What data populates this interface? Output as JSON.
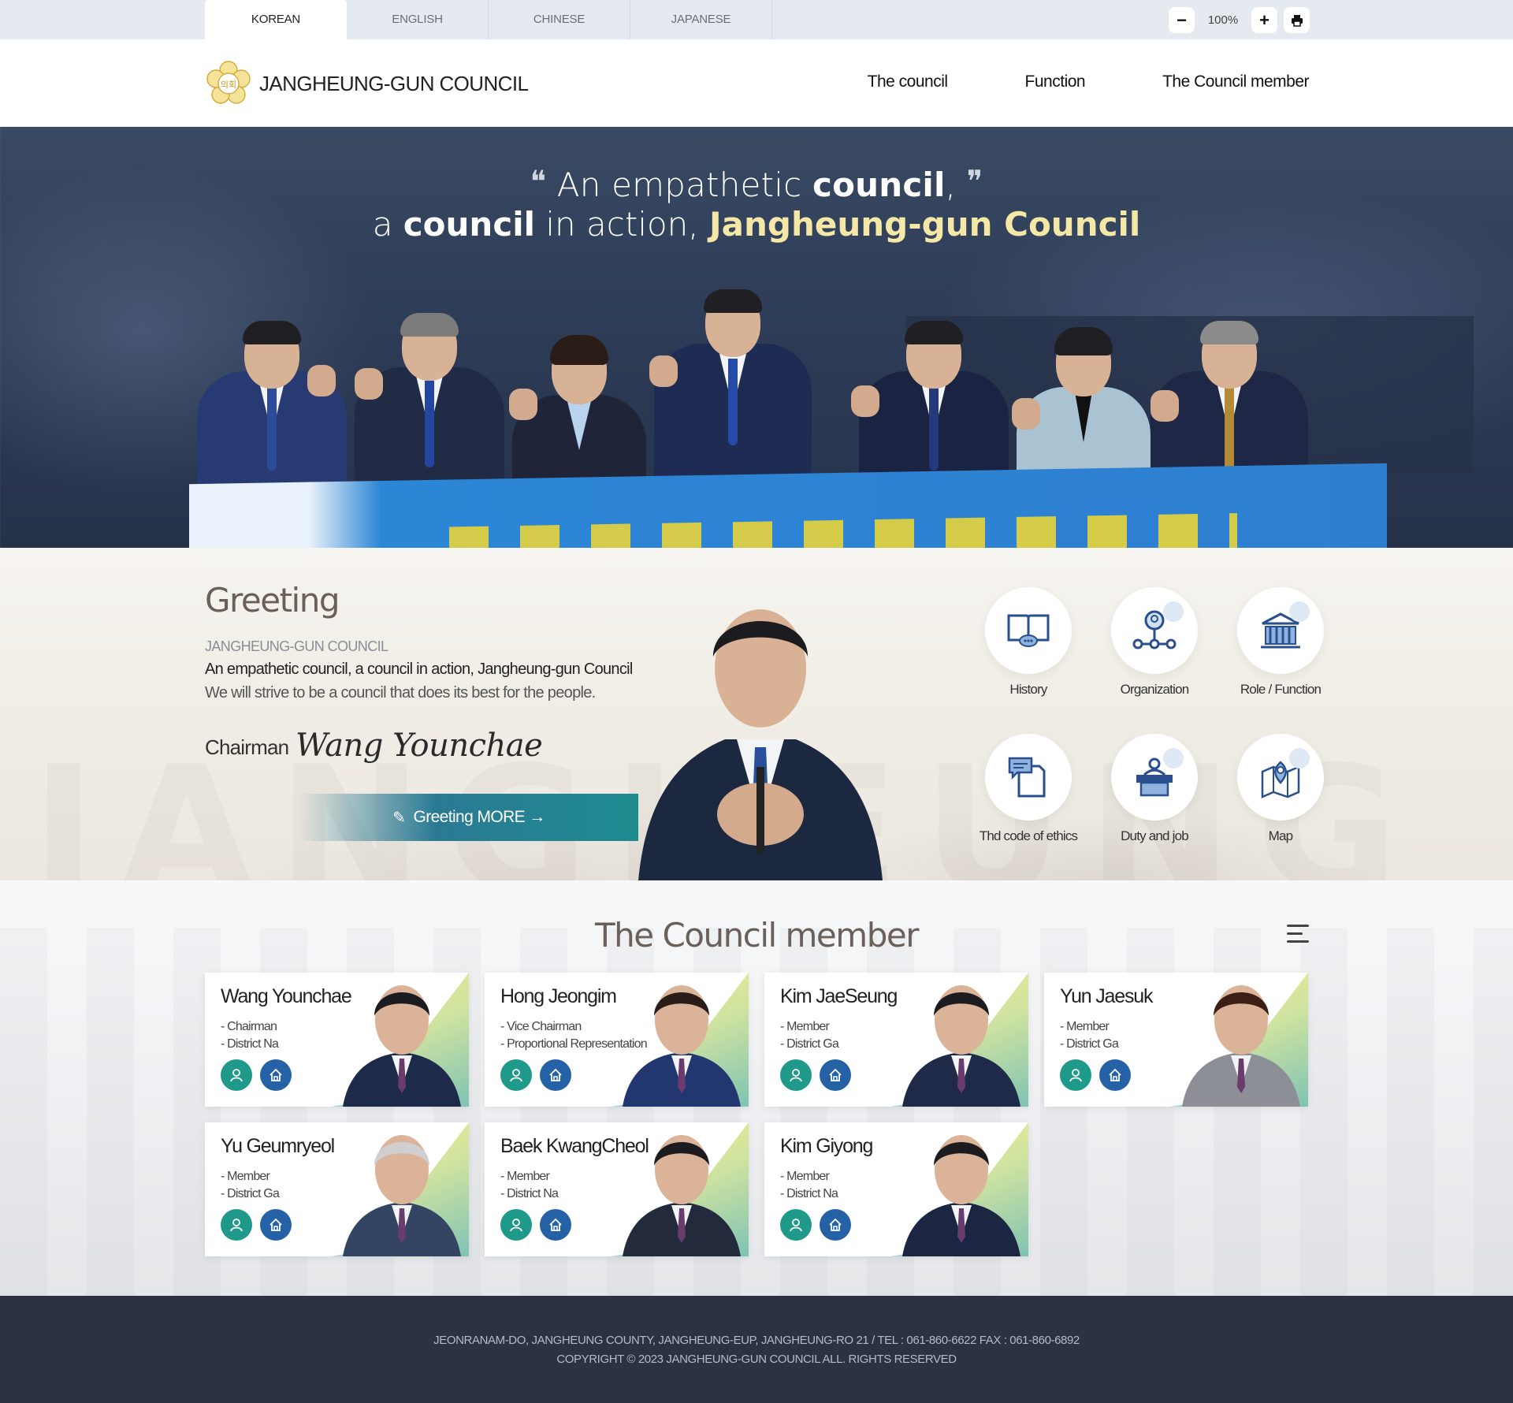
{
  "lang_tabs": [
    "KOREAN",
    "ENGLISH",
    "CHINESE",
    "JAPANESE"
  ],
  "tools": {
    "zoom_out": "−",
    "zoom_level": "100%",
    "zoom_in": "+",
    "print_icon": "print-icon"
  },
  "header": {
    "site_name": "JANGHEUNG-GUN COUNCIL",
    "emblem_text": "의회",
    "nav": [
      "The council",
      "Function",
      "The Council member"
    ]
  },
  "hero": {
    "open_quote": "❝",
    "line1_a": "An empathetic ",
    "line1_b": "council",
    "line1_c": ",",
    "close_quote": "❞",
    "line2_a": "a ",
    "line2_b": "council",
    "line2_c": " in action, ",
    "line2_d": "Jangheung-gun Council"
  },
  "greeting": {
    "title": "Greeting",
    "subtitle": "JANGHEUNG-GUN COUNCIL",
    "line1": "An empathetic council, a council in action, Jangheung-gun Council",
    "line2": "We will strive to be a council that does its best for the people.",
    "chairman_label": "Chairman",
    "signature": "Wang Younchae",
    "more_button": "Greeting MORE →"
  },
  "quick_links": [
    {
      "label": "History",
      "icon": "book-icon"
    },
    {
      "label": "Organization",
      "icon": "organization-icon"
    },
    {
      "label": "Role / Function",
      "icon": "building-icon"
    },
    {
      "label": "Thd code of ethics",
      "icon": "document-chat-icon"
    },
    {
      "label": "Duty and job",
      "icon": "podium-icon"
    },
    {
      "label": "Map",
      "icon": "map-pin-icon"
    }
  ],
  "members": {
    "title": "The Council member",
    "list": [
      {
        "name": "Wang Younchae",
        "role": "- Chairman",
        "district": "- District Na"
      },
      {
        "name": "Hong Jeongim",
        "role": "- Vice Chairman",
        "district": "- Proportional Representation"
      },
      {
        "name": "Kim JaeSeung",
        "role": "- Member",
        "district": "- District Ga"
      },
      {
        "name": "Yun Jaesuk",
        "role": "- Member",
        "district": "- District Ga"
      },
      {
        "name": "Yu Geumryeol",
        "role": "- Member",
        "district": "- District Ga"
      },
      {
        "name": "Baek KwangCheol",
        "role": "- Member",
        "district": "- District Na"
      },
      {
        "name": "Kim Giyong",
        "role": "- Member",
        "district": "- District Na"
      }
    ]
  },
  "footer": {
    "address": "JEONRANAM-DO, JANGHEUNG COUNTY, JANGHEUNG-EUP, JANGHEUNG-RO 21 / TEL : 061-860-6622 FAX : 061-860-6892",
    "copyright": "COPYRIGHT © 2023 JANGHEUNG-GUN COUNCIL ALL. RIGHTS RESERVED"
  },
  "colors": {
    "teal": "#1f9a8a",
    "blue": "#2561a5",
    "hero_yellow": "#f5e8a6",
    "footer_bg": "#2c3240"
  }
}
